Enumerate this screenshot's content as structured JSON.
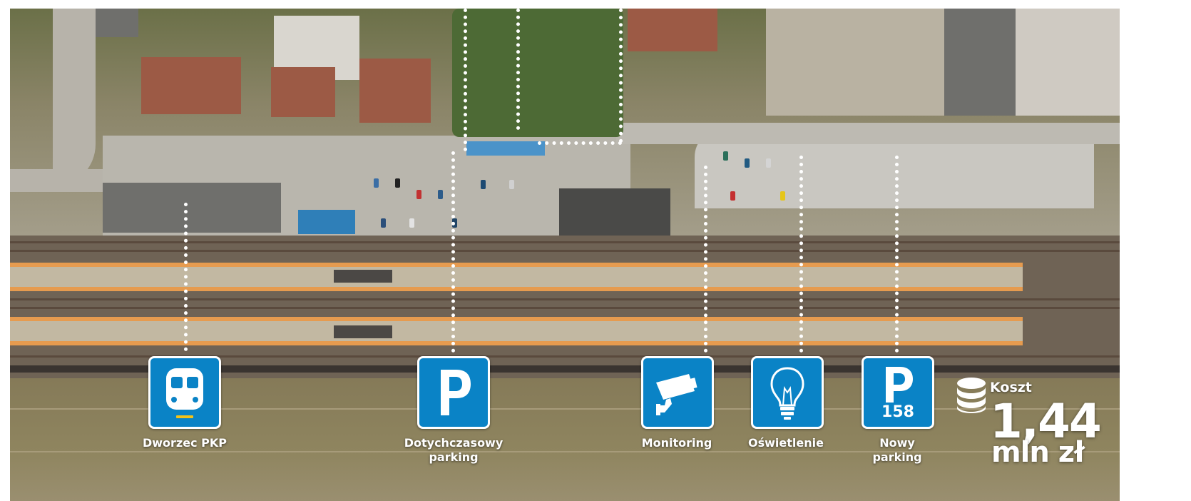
{
  "items": [
    {
      "label": "Dworzec PKP",
      "icon": "train-icon"
    },
    {
      "label": "Dotychczasowy parking",
      "icon": "parking-icon"
    },
    {
      "label": "Monitoring",
      "icon": "cctv-camera-icon"
    },
    {
      "label": "Oświetlenie",
      "icon": "light-bulb-icon"
    },
    {
      "label": "Nowy parking",
      "icon": "parking-icon",
      "badge": "158"
    }
  ],
  "cost": {
    "title": "Koszt",
    "value": "1,44",
    "unit": "mln zł",
    "icon": "coin-stack-icon"
  },
  "colors": {
    "tile": "#0a83c6",
    "accent_yellow": "#f2c21a",
    "text": "#ffffff"
  }
}
